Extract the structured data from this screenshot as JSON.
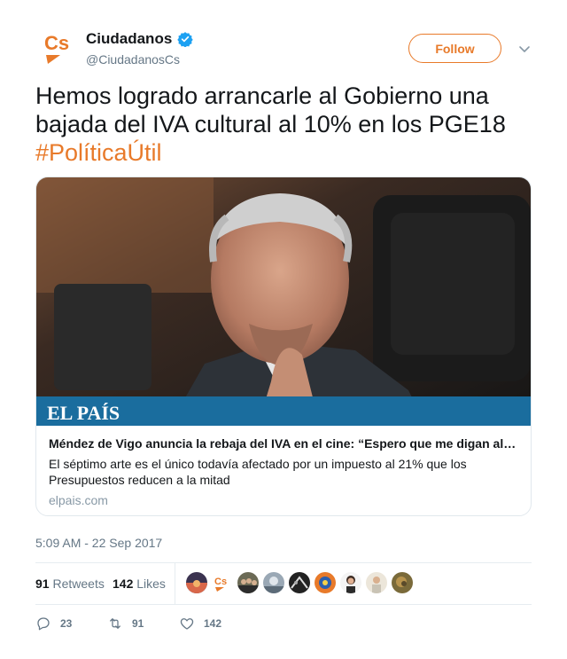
{
  "account": {
    "display_name": "Ciudadanos",
    "handle": "@CiudadanosCs",
    "avatar_text": "Cs",
    "verified_icon": "verified-badge-icon",
    "follow_label": "Follow"
  },
  "tweet": {
    "text": "Hemos logrado arrancarle al Gobierno una bajada del IVA cultural al 10% en los PGE18 ",
    "hashtag": "#PolíticaÚtil"
  },
  "card": {
    "image_brand": "EL PAÍS",
    "title": "Méndez de Vigo anuncia la rebaja del IVA en el cine: “Espero que me digan al…",
    "description": "El séptimo arte es el único todavía afectado por un impuesto al 21% que los Presupuestos reducen a la mitad",
    "domain": "elpais.com"
  },
  "timestamp": "5:09 AM - 22 Sep 2017",
  "stats": {
    "retweets_count": "91",
    "retweets_label": "Retweets",
    "likes_count": "142",
    "likes_label": "Likes"
  },
  "actions": {
    "reply_count": "23",
    "retweet_count": "91",
    "like_count": "142"
  },
  "colors": {
    "accent": "#e87a2a",
    "text": "#14171a",
    "muted": "#657786",
    "verified": "#1da1f2",
    "elpais_bar": "#1a6d9e"
  }
}
